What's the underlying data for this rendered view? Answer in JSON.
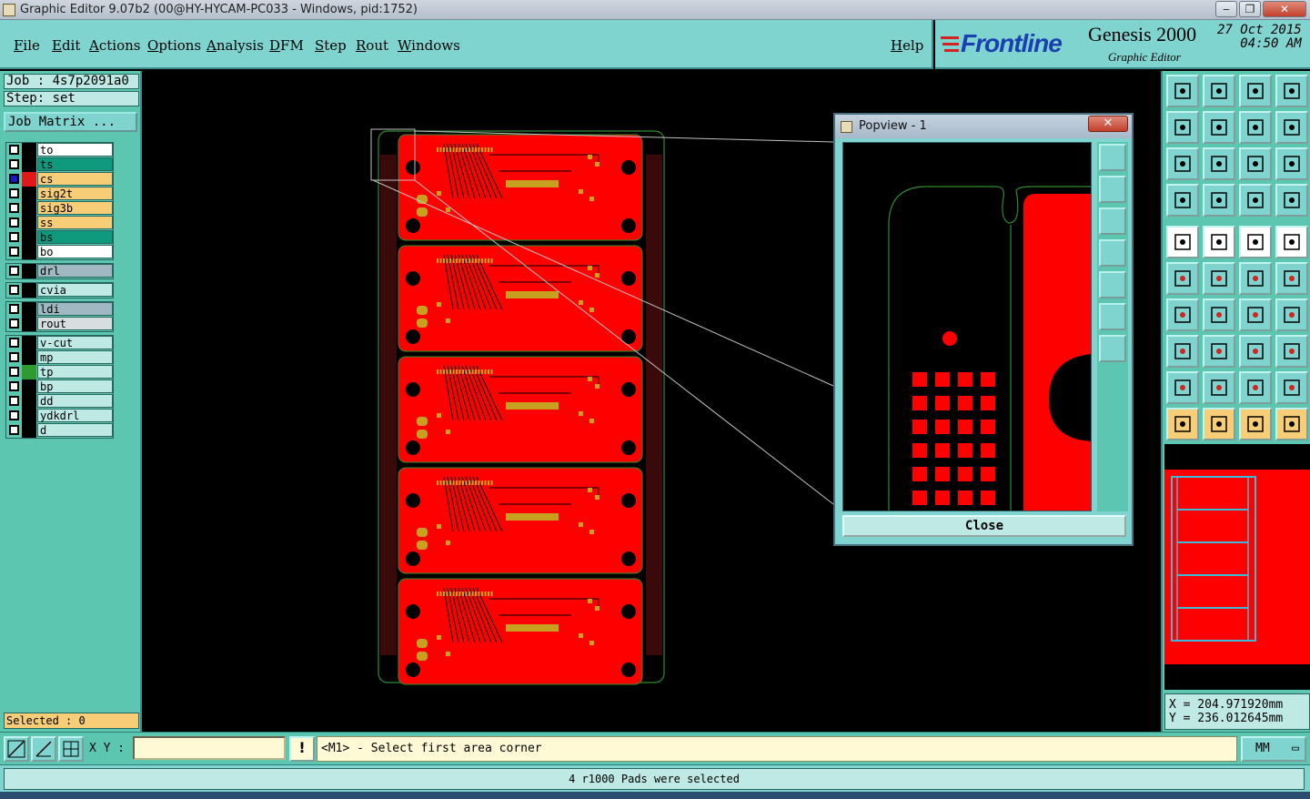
{
  "window": {
    "title": "Graphic Editor 9.07b2 (00@HY-HYCAM-PC033 - Windows, pid:1752)",
    "minimize": "‒",
    "maximize": "❐",
    "close": "✕"
  },
  "menu": {
    "items": [
      "File",
      "Edit",
      "Actions",
      "Options",
      "Analysis",
      "DFM",
      "Step",
      "Rout",
      "Windows"
    ],
    "help": "Help"
  },
  "brand": {
    "logo": "Frontline",
    "product": "Genesis 2000",
    "subtitle": "Graphic Editor",
    "date": "27 Oct 2015",
    "time": "04:50 AM"
  },
  "job": {
    "job_label": "Job : 4s7p2091a0",
    "step_label": "Step: set",
    "matrix_button": "Job Matrix ..."
  },
  "layers": {
    "group1": [
      {
        "name": "to",
        "color": "#ffffff",
        "swatch": "#000000"
      },
      {
        "name": "ts",
        "color": "#0f9a7e",
        "swatch": "#000000"
      },
      {
        "name": "cs",
        "color": "#f7cd78",
        "swatch": "#e01818",
        "active": true
      },
      {
        "name": "sig2t",
        "color": "#f7cd78",
        "swatch": "#000000"
      },
      {
        "name": "sig3b",
        "color": "#f7cd78",
        "swatch": "#000000"
      },
      {
        "name": "ss",
        "color": "#f7cd78",
        "swatch": "#000000"
      },
      {
        "name": "bs",
        "color": "#0f9a7e",
        "swatch": "#000000"
      },
      {
        "name": "bo",
        "color": "#ffffff",
        "swatch": "#000000"
      }
    ],
    "group2": [
      {
        "name": "drl",
        "color": "#9fb8c2",
        "swatch": "#000000"
      }
    ],
    "group3": [
      {
        "name": "cvia",
        "color": "#bfe9e4",
        "swatch": "#000000"
      }
    ],
    "group4": [
      {
        "name": "ldi",
        "color": "#9fb8c2",
        "swatch": "#000000"
      },
      {
        "name": "rout",
        "color": "#d8dde0",
        "swatch": "#000000"
      }
    ],
    "group5": [
      {
        "name": "v-cut",
        "color": "#bfe9e4",
        "swatch": "#000000"
      },
      {
        "name": "mp",
        "color": "#bfe9e4",
        "swatch": "#000000"
      },
      {
        "name": "tp",
        "color": "#bfe9e4",
        "swatch": "#2f9a2f"
      },
      {
        "name": "bp",
        "color": "#bfe9e4",
        "swatch": "#000000"
      },
      {
        "name": "dd",
        "color": "#bfe9e4",
        "swatch": "#000000"
      },
      {
        "name": "ydkdrl",
        "color": "#bfe9e4",
        "swatch": "#000000"
      },
      {
        "name": "d",
        "color": "#bfe9e4",
        "swatch": "#000000"
      }
    ]
  },
  "selected": "Selected : 0",
  "popview": {
    "title": "Popview - 1",
    "close_x": "✕",
    "close_button": "Close"
  },
  "status": {
    "xy_label": "X Y :",
    "xy_value": "",
    "prompt": "<M1> - Select first area corner",
    "units": "MM",
    "message": "4 r1000 Pads were selected"
  },
  "coords": {
    "x": "X = 204.971920mm",
    "y": "Y = 236.012645mm"
  },
  "colors": {
    "panel": "#5cc6b1",
    "menubar": "#7fd4d0",
    "pcb_copper": "#ff0000",
    "pad": "#c8a020",
    "outline": "#2e8b2e"
  }
}
